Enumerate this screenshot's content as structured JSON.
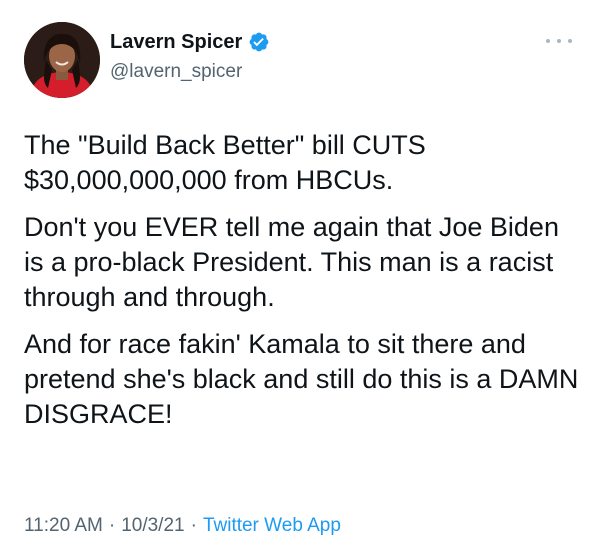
{
  "author": {
    "display_name": "Lavern Spicer",
    "handle": "@lavern_spicer",
    "verified": true,
    "verified_icon": "verified-badge-icon",
    "verified_color": "#1d9bf0"
  },
  "tweet": {
    "paragraphs": [
      "The \"Build Back Better\" bill CUTS $30,000,000,000 from HBCUs.",
      "Don't you EVER tell me again that Joe Biden is a pro-black President. This man is a racist through and through.",
      "And for race fakin' Kamala to sit there and pretend she's black and still do this is a DAMN DISGRACE!"
    ]
  },
  "meta": {
    "time": "11:20 AM",
    "date": "10/3/21",
    "separator": "·",
    "source_app": "Twitter Web App",
    "link_color": "#1d9bf0"
  },
  "more_menu_icon": "more-horizontal-icon"
}
